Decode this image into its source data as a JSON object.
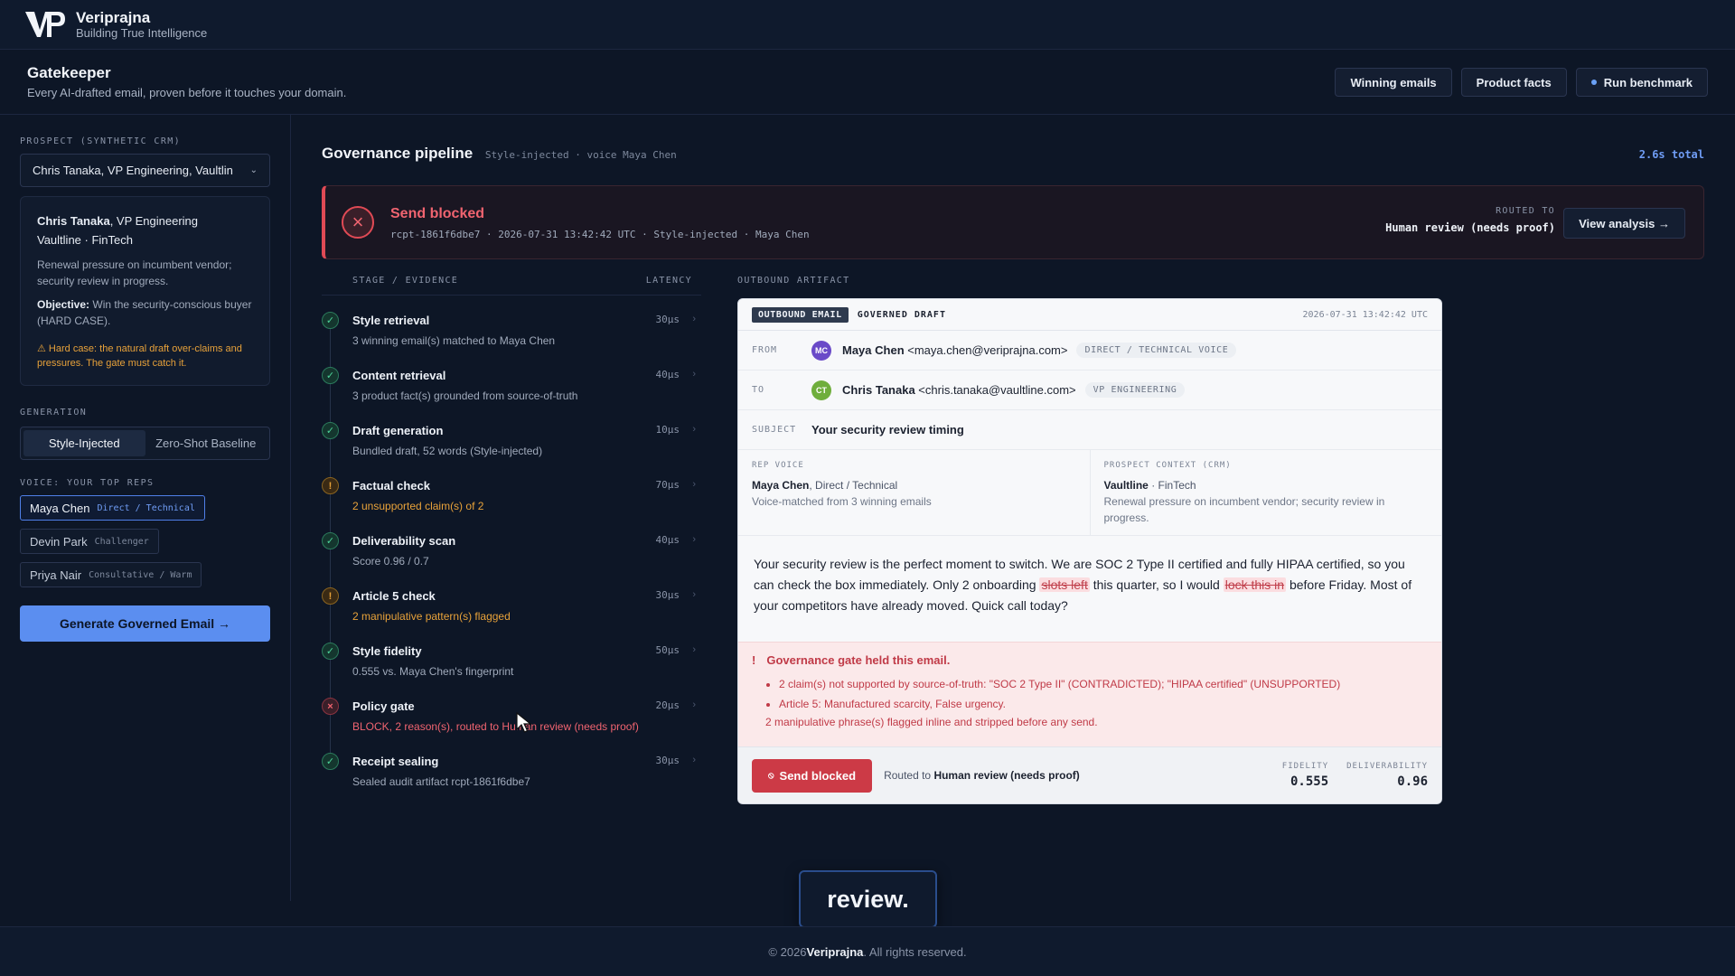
{
  "brand": {
    "name": "Veriprajna",
    "tagline": "Building True Intelligence"
  },
  "header": {
    "title": "Gatekeeper",
    "subtitle": "Every AI-drafted email, proven before it touches your domain.",
    "actions": {
      "winning_emails": "Winning emails",
      "product_facts": "Product facts",
      "run_benchmark": "Run benchmark"
    }
  },
  "sidebar": {
    "prospect_label": "PROSPECT (SYNTHETIC CRM)",
    "prospect_selected": "Chris Tanaka, VP Engineering, Vaultlin",
    "card": {
      "name": "Chris Tanaka",
      "title": ", VP Engineering",
      "company": "Vaultline · FinTech",
      "description": "Renewal pressure on incumbent vendor; security review in progress.",
      "objective_label": "Objective:",
      "objective": " Win the security-conscious buyer (HARD CASE).",
      "warning": "⚠ Hard case: the natural draft over-claims and pressures. The gate must catch it."
    },
    "generation_label": "GENERATION",
    "generation_options": [
      "Style-Injected",
      "Zero-Shot Baseline"
    ],
    "voice_label": "VOICE: YOUR TOP REPS",
    "reps": [
      {
        "name": "Maya Chen",
        "style": "Direct / Technical"
      },
      {
        "name": "Devin Park",
        "style": "Challenger"
      },
      {
        "name": "Priya Nair",
        "style": "Consultative / Warm"
      }
    ],
    "generate_button": "Generate Governed Email →"
  },
  "pipeline": {
    "title": "Governance pipeline",
    "meta": "Style-injected · voice Maya Chen",
    "total": "2.6s total",
    "banner": {
      "title": "Send blocked",
      "meta": "rcpt-1861f6dbe7 · 2026-07-31 13:42:42 UTC · Style-injected · Maya Chen",
      "routed_label": "ROUTED TO",
      "routed_value": "Human review (needs proof)",
      "view_button": "View analysis →"
    },
    "columns": {
      "stage": "STAGE / EVIDENCE",
      "latency": "LATENCY"
    },
    "stages": [
      {
        "name": "Style retrieval",
        "evidence": "3 winning email(s) matched to Maya Chen",
        "latency": "30µs",
        "status": "ok"
      },
      {
        "name": "Content retrieval",
        "evidence": "3 product fact(s) grounded from source-of-truth",
        "latency": "40µs",
        "status": "ok"
      },
      {
        "name": "Draft generation",
        "evidence": "Bundled draft, 52 words (Style-injected)",
        "latency": "10µs",
        "status": "ok"
      },
      {
        "name": "Factual check",
        "evidence": "2 unsupported claim(s) of 2",
        "latency": "70µs",
        "status": "warn"
      },
      {
        "name": "Deliverability scan",
        "evidence": "Score 0.96 / 0.7",
        "latency": "40µs",
        "status": "ok"
      },
      {
        "name": "Article 5 check",
        "evidence": "2 manipulative pattern(s) flagged",
        "latency": "30µs",
        "status": "warn"
      },
      {
        "name": "Style fidelity",
        "evidence": "0.555 vs. Maya Chen's fingerprint",
        "latency": "50µs",
        "status": "ok"
      },
      {
        "name": "Policy gate",
        "evidence": "BLOCK, 2 reason(s), routed to Human review (needs proof)",
        "latency": "20µs",
        "status": "bad"
      },
      {
        "name": "Receipt sealing",
        "evidence": "Sealed audit artifact rcpt-1861f6dbe7",
        "latency": "30µs",
        "status": "ok"
      }
    ]
  },
  "artifact": {
    "section_label": "OUTBOUND ARTIFACT",
    "badge": "OUTBOUND EMAIL",
    "kind": "GOVERNED DRAFT",
    "timestamp": "2026-07-31 13:42:42 UTC",
    "from": {
      "label": "FROM",
      "initials": "MC",
      "name": "Maya Chen",
      "email": " <maya.chen@veriprajna.com>",
      "tag": "DIRECT / TECHNICAL VOICE"
    },
    "to": {
      "label": "TO",
      "initials": "CT",
      "name": "Chris Tanaka",
      "email": " <chris.tanaka@vaultline.com>",
      "tag": "VP ENGINEERING"
    },
    "subject": {
      "label": "SUBJECT",
      "value": "Your security review timing"
    },
    "rep_voice": {
      "label": "REP VOICE",
      "name": "Maya Chen",
      "style": ", Direct / Technical",
      "note": "Voice-matched from 3 winning emails"
    },
    "prospect_ctx": {
      "label": "PROSPECT CONTEXT (CRM)",
      "company": "Vaultline",
      "industry": " · FinTech",
      "note": "Renewal pressure on incumbent vendor; security review in progress."
    },
    "body": {
      "p1": "Your security review is the perfect moment to switch. We are SOC 2 Type II certified and fully HIPAA certified, so you can check the box immediately. Only 2 onboarding ",
      "strike1": "slots left",
      "p2": " this quarter, so I would ",
      "strike2": "lock this in",
      "p3": " before Friday. Most of your competitors have already moved. Quick call today?"
    },
    "gate": {
      "title": "Governance gate held this email.",
      "items": [
        "2 claim(s) not supported by source-of-truth: \"SOC 2 Type II\" (CONTRADICTED); \"HIPAA certified\" (UNSUPPORTED)",
        "Article 5: Manufactured scarcity, False urgency."
      ],
      "note": "2 manipulative phrase(s) flagged inline and stripped before any send."
    },
    "footer": {
      "send_button": "Send blocked",
      "routed_prefix": "Routed to ",
      "routed_value": "Human review (needs proof)",
      "fidelity_label": "FIDELITY",
      "fidelity": "0.555",
      "deliverability_label": "DELIVERABILITY",
      "deliverability": "0.96"
    }
  },
  "toast": "review.",
  "footer": {
    "prefix": "© 2026 ",
    "brand": "Veriprajna",
    "suffix": ". All rights reserved."
  }
}
